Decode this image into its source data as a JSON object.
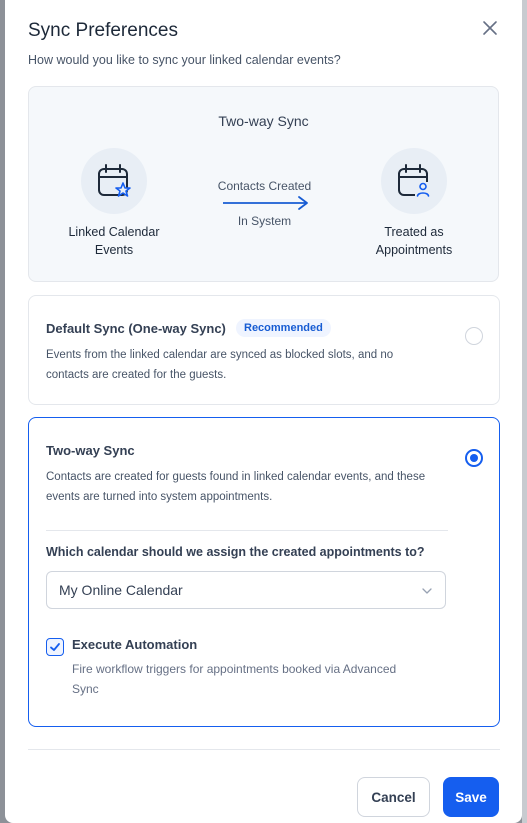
{
  "dialog": {
    "title": "Sync Preferences",
    "subtitle": "How would you like to sync your linked calendar events?"
  },
  "diagram": {
    "title": "Two-way Sync",
    "left_node": {
      "label_line1": "Linked Calendar",
      "label_line2": "Events",
      "icon": "calendar-star-icon"
    },
    "arrow_top": "Contacts Created",
    "arrow_bottom": "In System",
    "right_node": {
      "label_line1": "Treated as",
      "label_line2": "Appointments",
      "icon": "calendar-user-icon"
    }
  },
  "options": {
    "default_sync": {
      "title": "Default Sync (One-way Sync)",
      "badge": "Recommended",
      "desc_line1": "Events from the linked calendar are synced as blocked slots, and no",
      "desc_line2": "contacts are created for the guests.",
      "selected": false
    },
    "two_way_sync": {
      "title": "Two-way Sync",
      "desc_line1": "Contacts are created for guests found in linked calendar events, and these",
      "desc_line2": "events are turned into system appointments.",
      "selected": true,
      "question": "Which calendar should we assign the created appointments to?",
      "calendar_select": {
        "value": "My Online Calendar"
      },
      "automation": {
        "label": "Execute Automation",
        "desc_line1": "Fire workflow triggers for appointments booked via Advanced",
        "desc_line2": "Sync",
        "checked": true
      }
    }
  },
  "footer": {
    "cancel_label": "Cancel",
    "save_label": "Save"
  },
  "colors": {
    "primary": "#155eef",
    "badge_bg": "#eff4ff",
    "diagram_bg": "#f5f8fb",
    "icon_circle_bg": "#e8eef5"
  }
}
